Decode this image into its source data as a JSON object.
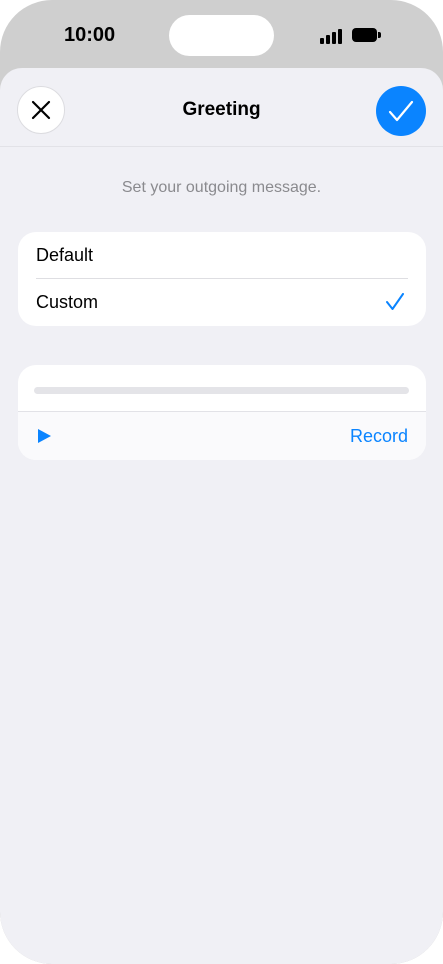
{
  "status_bar": {
    "time": "10:00",
    "icons": [
      "signal-icon",
      "battery-icon"
    ]
  },
  "nav": {
    "title": "Greeting",
    "close_icon": "close-icon",
    "done_icon": "checkmark-icon"
  },
  "subtitle": "Set your outgoing message.",
  "greeting_options": [
    {
      "label": "Default",
      "selected": false
    },
    {
      "label": "Custom",
      "selected": true
    }
  ],
  "recorder": {
    "progress": 0,
    "play_icon": "play-icon",
    "record_label": "Record"
  },
  "colors": {
    "accent": "#0a84ff",
    "background": "#f0f0f5",
    "card": "#ffffff",
    "secondary_text": "#8a8a8e"
  }
}
